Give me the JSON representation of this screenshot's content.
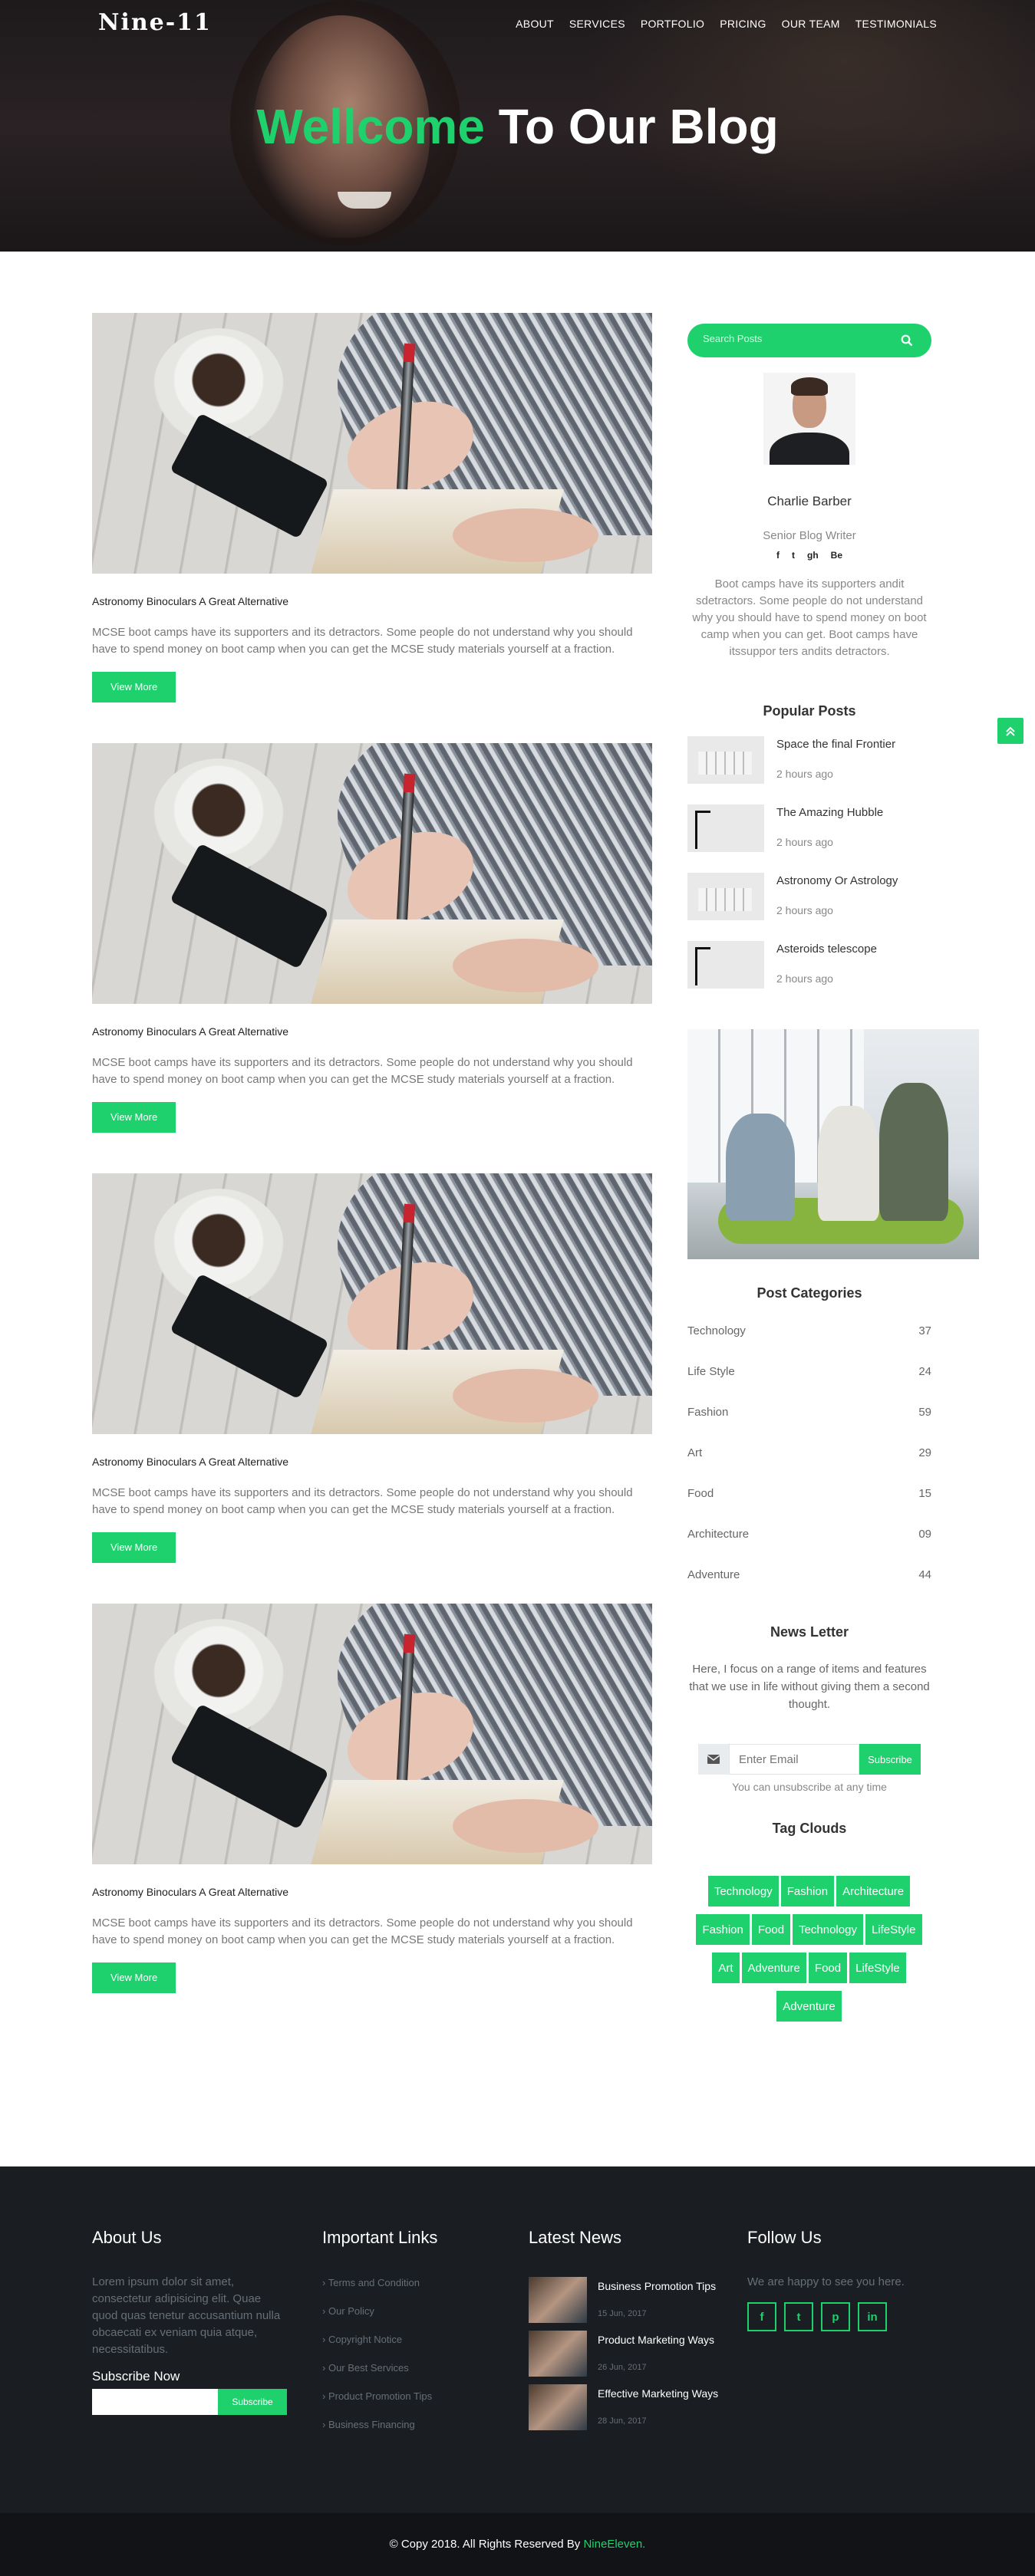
{
  "brand": {
    "logo": "Nine-11",
    "accent": "#1ed16d"
  },
  "nav": {
    "items": [
      "ABOUT",
      "SERVICES",
      "PORTFOLIO",
      "PRICING",
      "OUR TEAM",
      "TESTIMONIALS"
    ]
  },
  "hero": {
    "title_accent": "Wellcome",
    "title_rest": " To Our Blog"
  },
  "posts": [
    {
      "category": "Astronomy Binoculars A Great Alternative",
      "text": "MCSE boot camps have its supporters and its detractors. Some people do not understand why you should have to spend money on boot camp when you can get the MCSE study materials yourself at a fraction.",
      "button": "View More"
    },
    {
      "category": "Astronomy Binoculars A Great Alternative",
      "text": "MCSE boot camps have its supporters and its detractors. Some people do not understand why you should have to spend money on boot camp when you can get the MCSE study materials yourself at a fraction.",
      "button": "View More"
    },
    {
      "category": "Astronomy Binoculars A Great Alternative",
      "text": "MCSE boot camps have its supporters and its detractors. Some people do not understand why you should have to spend money on boot camp when you can get the MCSE study materials yourself at a fraction.",
      "button": "View More"
    },
    {
      "category": "Astronomy Binoculars A Great Alternative",
      "text": "MCSE boot camps have its supporters and its detractors. Some people do not understand why you should have to spend money on boot camp when you can get the MCSE study materials yourself at a fraction.",
      "button": "View More"
    }
  ],
  "sidebar": {
    "search_placeholder": "Search Posts",
    "author": {
      "name": "Charlie Barber",
      "role": "Senior Blog Writer",
      "socials": [
        "f",
        "t",
        "gh",
        "Be"
      ],
      "bio": "Boot camps have its supporters andit sdetractors. Some people do not understand why you should have to spend money on boot camp when you can get. Boot camps have itssuppor ters andits detractors."
    },
    "popular_title": "Popular Posts",
    "popular": [
      {
        "title": "Space the final Frontier",
        "time": "2 hours ago"
      },
      {
        "title": "The Amazing Hubble",
        "time": "2 hours ago"
      },
      {
        "title": "Astronomy Or Astrology",
        "time": "2 hours ago"
      },
      {
        "title": "Asteroids telescope",
        "time": "2 hours ago"
      }
    ],
    "categories_title": "Post Categories",
    "categories": [
      {
        "name": "Technology",
        "count": "37"
      },
      {
        "name": "Life Style",
        "count": "24"
      },
      {
        "name": "Fashion",
        "count": "59"
      },
      {
        "name": "Art",
        "count": "29"
      },
      {
        "name": "Food",
        "count": "15"
      },
      {
        "name": "Architecture",
        "count": "09"
      },
      {
        "name": "Adventure",
        "count": "44"
      }
    ],
    "newsletter_title": "News Letter",
    "newsletter_text": "Here, I focus on a range of items and features that we use in life without giving them a second thought.",
    "newsletter_placeholder": "Enter Email",
    "newsletter_button": "Subscribe",
    "newsletter_note": "You can unsubscribe at any time",
    "tags_title": "Tag Clouds",
    "tags": [
      "Technology",
      "Fashion",
      "Architecture",
      "Fashion",
      "Food",
      "Technology",
      "LifeStyle",
      "Art",
      "Adventure",
      "Food",
      "LifeStyle",
      "Adventure"
    ]
  },
  "footer": {
    "about_title": "About Us",
    "about_text": "Lorem ipsum dolor sit amet, consectetur adipisicing elit. Quae quod quas tenetur accusantium nulla obcaecati ex veniam quia atque, necessitatibus.",
    "subscribe_title": "Subscribe Now",
    "subscribe_button": "Subscribe",
    "links_title": "Important Links",
    "links": [
      "Terms and Condition",
      "Our Policy",
      "Copyright Notice",
      "Our Best Services",
      "Product Promotion Tips",
      "Business Financing"
    ],
    "news_title": "Latest News",
    "news": [
      {
        "title": "Business Promotion Tips",
        "date": "15 Jun, 2017"
      },
      {
        "title": "Product Marketing Ways",
        "date": "26 Jun, 2017"
      },
      {
        "title": "Effective Marketing Ways",
        "date": "28 Jun, 2017"
      }
    ],
    "follow_title": "Follow Us",
    "follow_text": "We are happy to see you here.",
    "follow_icons": [
      "f",
      "t",
      "p",
      "in"
    ],
    "copyright": "© Copy 2018. All Rights Reserved By ",
    "copyright_brand": "NineEleven."
  }
}
